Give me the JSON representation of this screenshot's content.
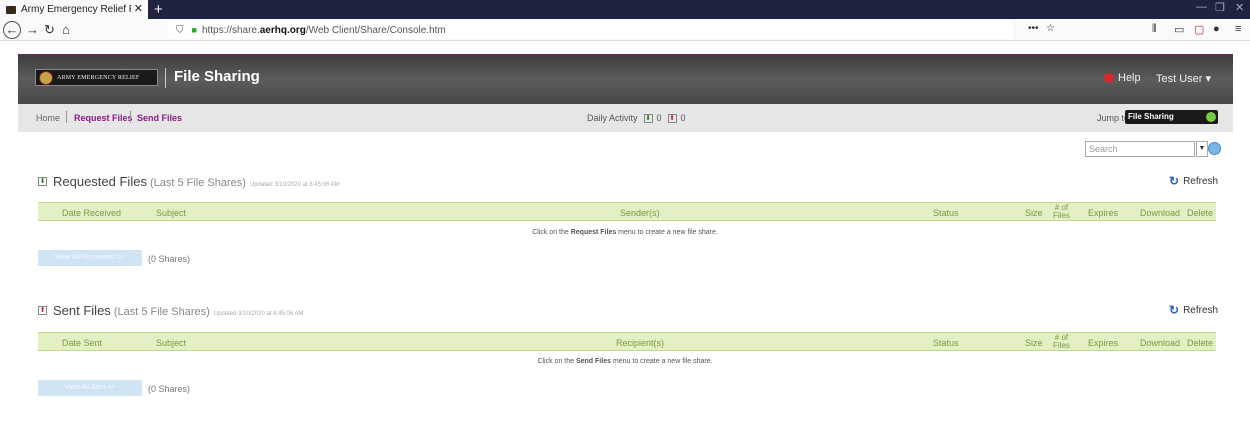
{
  "browser": {
    "tab_title": "Army Emergency Relief Resour",
    "new_tab": "+",
    "url_prefix": "https://share.",
    "url_domain": "aerhq.org",
    "url_suffix": "/Web Client/Share/Console.htm"
  },
  "header": {
    "logo_text": "ARMY EMERGENCY RELIEF",
    "title": "File Sharing",
    "help": "Help",
    "user": "Test User ▾"
  },
  "subnav": {
    "home": "Home",
    "request_files": "Request Files",
    "send_files": "Send Files",
    "daily_label": "Daily Activity",
    "daily_in": "0",
    "daily_out": "0",
    "jump_label": "Jump to:",
    "jump_value": "File Sharing"
  },
  "search": {
    "placeholder": "Search"
  },
  "requested": {
    "title": "Requested Files",
    "subtitle": "(Last 5 File Shares)",
    "updated": "Updated 3/10/2020 at 8:45:06 AM",
    "refresh": "Refresh",
    "columns": {
      "date": "Date Received",
      "subject": "Subject",
      "party": "Sender(s)",
      "status": "Status",
      "size": "Size",
      "files_1": "# of",
      "files_2": "Files",
      "expires": "Expires",
      "download": "Download",
      "delete": "Delete"
    },
    "empty_pre": "Click on the ",
    "empty_link": "Request Files",
    "empty_post": " menu to create a new file share.",
    "view_all": "View All Requested >>",
    "count": "(0 Shares)"
  },
  "sent": {
    "title": "Sent Files",
    "subtitle": "(Last 5 File Shares)",
    "updated": "Updated 3/10/2020 at 8:45:06 AM",
    "refresh": "Refresh",
    "columns": {
      "date": "Date Sent",
      "subject": "Subject",
      "party": "Recipient(s)",
      "status": "Status",
      "size": "Size",
      "files_1": "# of",
      "files_2": "Files",
      "expires": "Expires",
      "download": "Download",
      "delete": "Delete"
    },
    "empty_pre": "Click on the ",
    "empty_link": "Send Files",
    "empty_post": " menu to create a new file share.",
    "view_all": "View All Sent >>",
    "count": "(0 Shares)"
  },
  "colors": {
    "accent_purple": "#8b1a8b",
    "table_header_bg": "#e3f0c5",
    "header_dark": "#474747"
  }
}
